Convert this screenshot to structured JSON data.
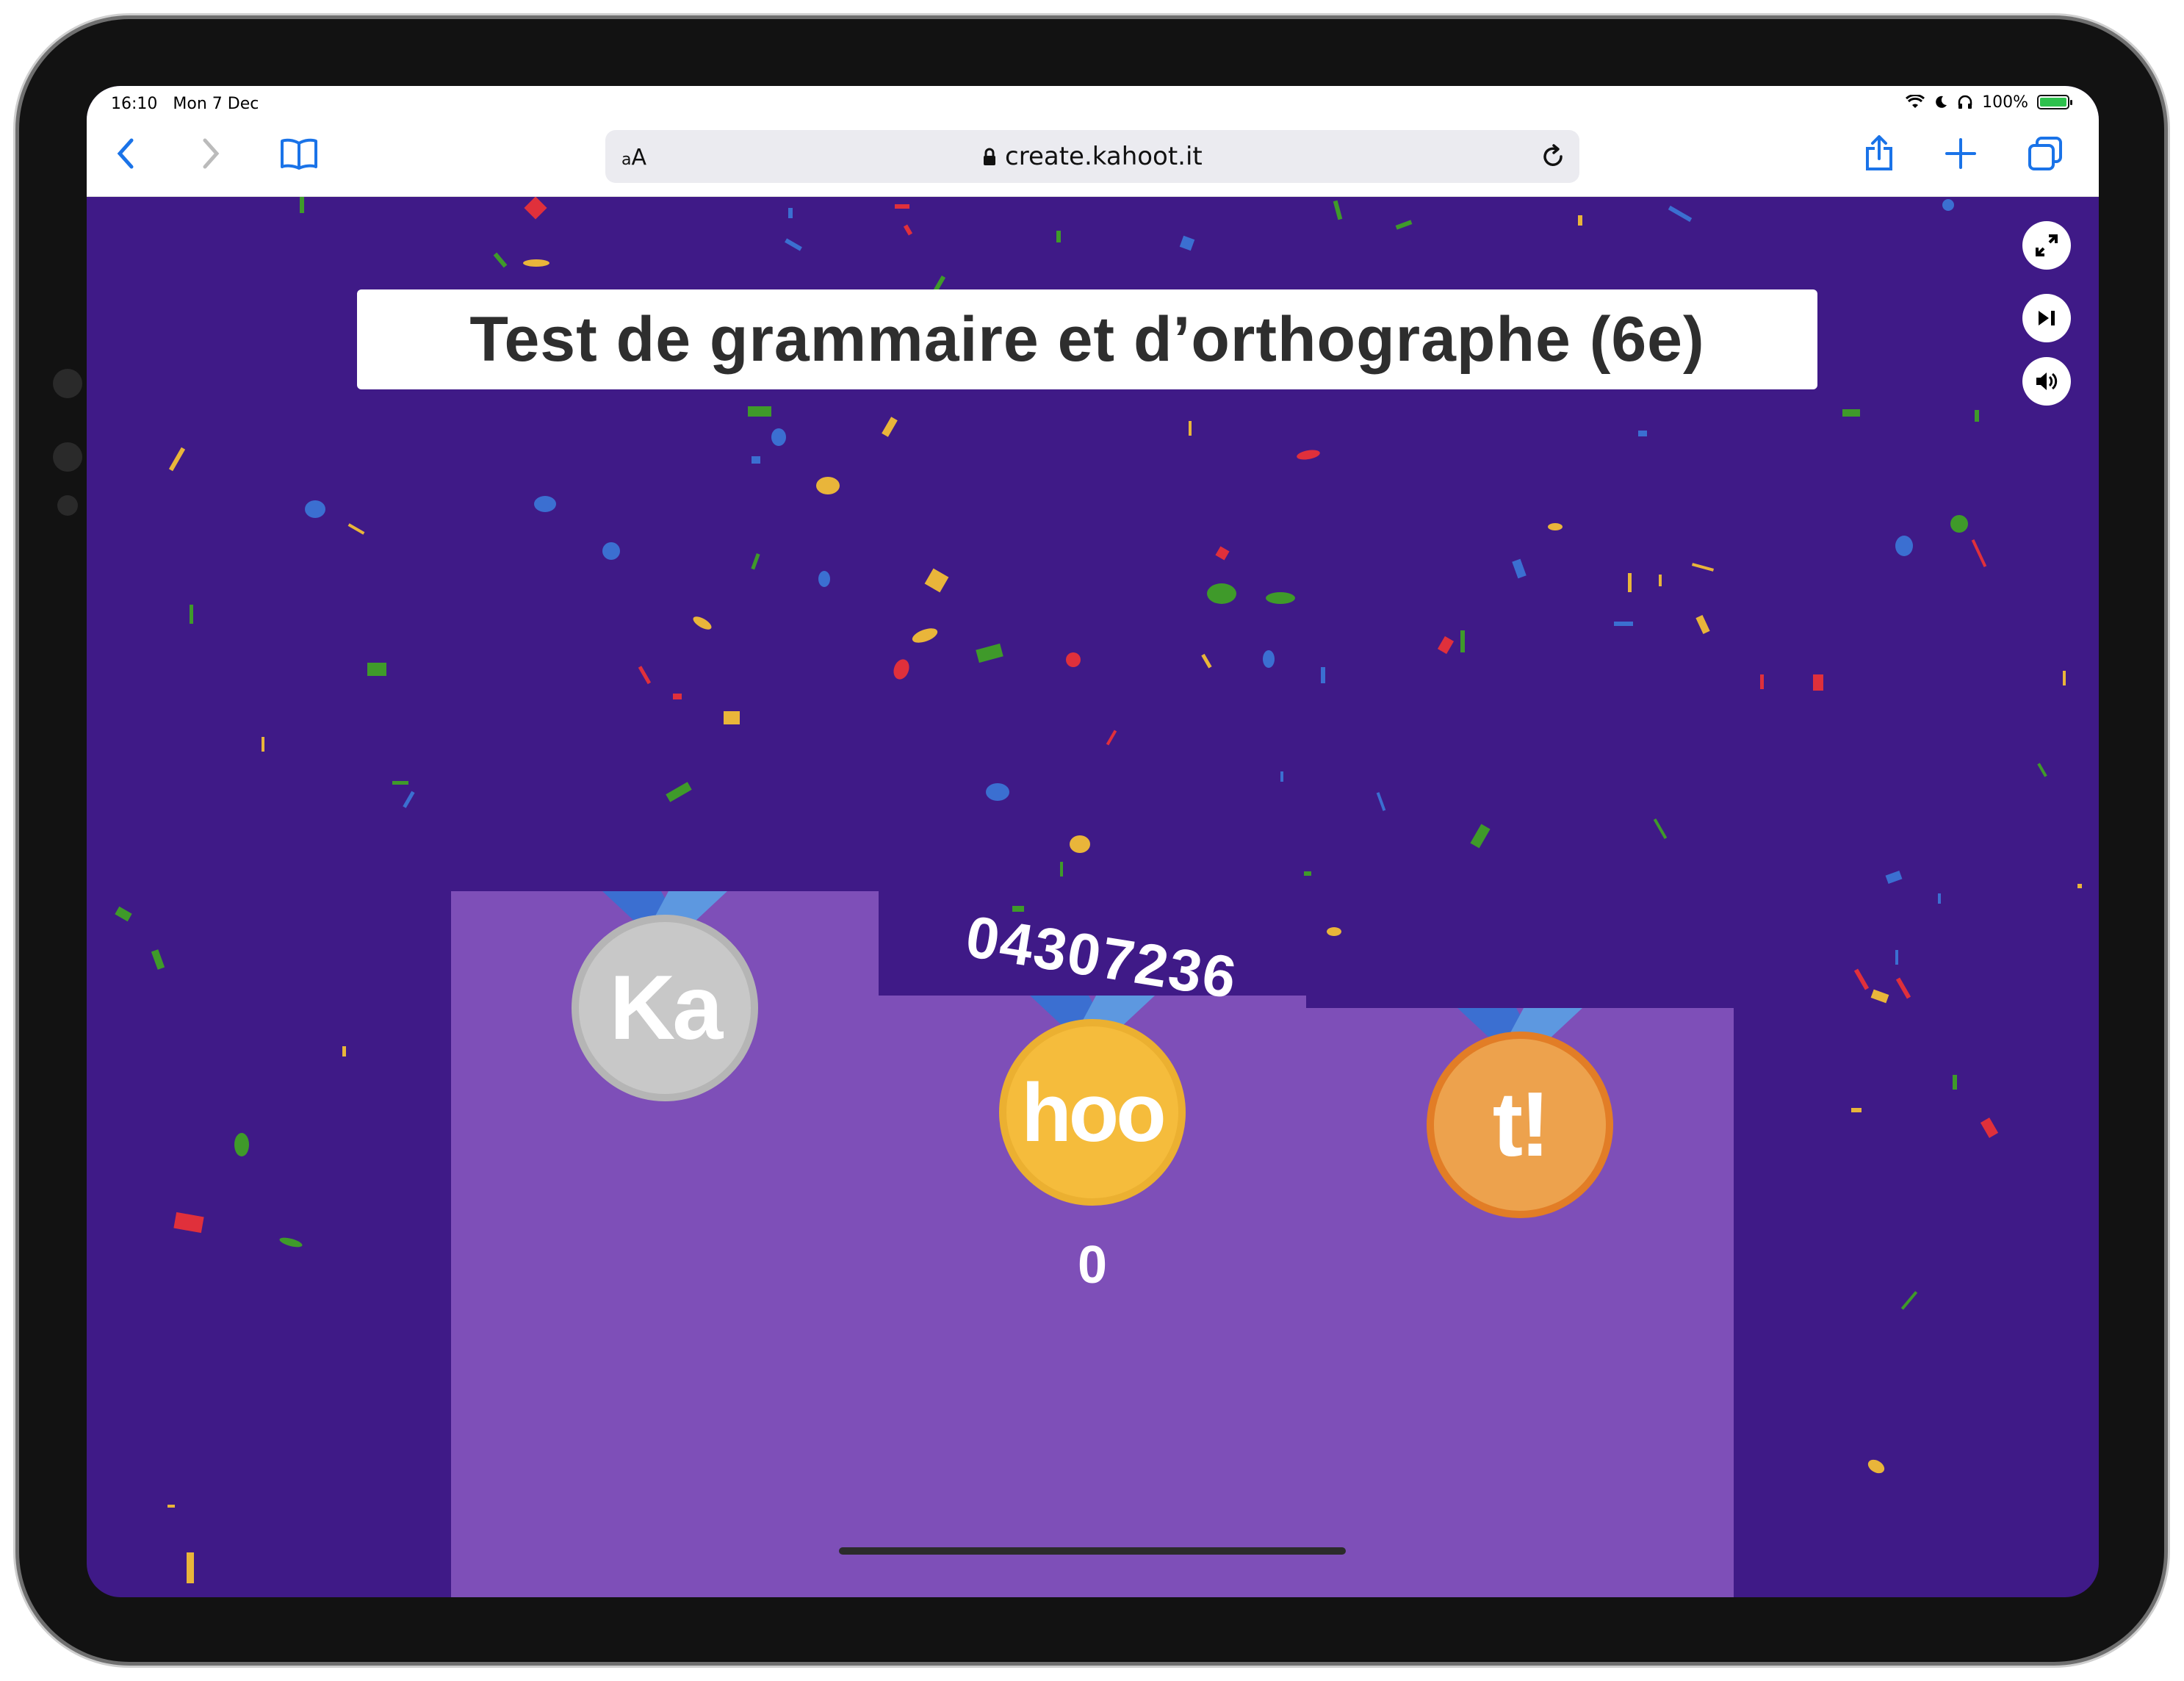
{
  "status": {
    "time": "16:10",
    "date": "Mon 7 Dec",
    "battery": "100%"
  },
  "browser": {
    "address_prefix": "AA",
    "url": "create.kahoot.it",
    "icons": [
      "back-icon",
      "forward-icon",
      "bookmarks-icon",
      "lock-icon",
      "reload-icon",
      "share-icon",
      "new-tab-icon",
      "tabs-icon"
    ]
  },
  "game": {
    "title": "Test de grammaire et d’orthographe (6e)",
    "controls": [
      "fullscreen-icon",
      "skip-icon",
      "volume-icon"
    ],
    "podium": [
      {
        "place": "second",
        "medal_text": "Ka",
        "medal_color": "#c8c8c8"
      },
      {
        "place": "first",
        "medal_text": "hoo",
        "medal_color": "#f5bc3c",
        "player": "04307236",
        "score": "0"
      },
      {
        "place": "third",
        "medal_text": "t!",
        "medal_color": "#eda24d"
      }
    ]
  },
  "colors": {
    "background": "#3f1a87",
    "podium": "#7e4fb8",
    "ribbon": "#3b6fd1"
  }
}
